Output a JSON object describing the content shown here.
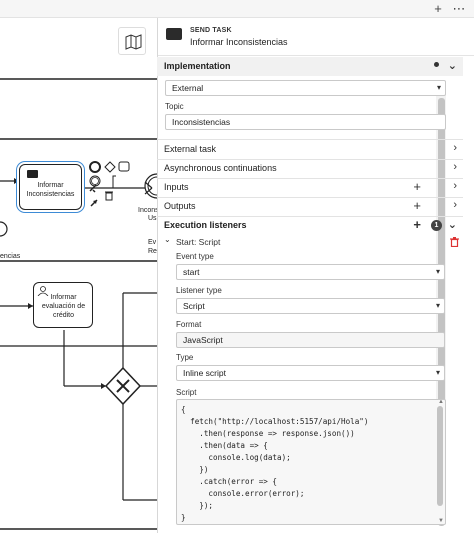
{
  "window": {
    "plus_icon": "+",
    "more_icon": "⋯"
  },
  "canvas": {
    "task_informar_inconsistencias": "Informar Inconsistencias",
    "task_informar_evaluacion": "Informar evaluación de crédito",
    "partial_label_left": "encias",
    "partial_label_1": "Incons",
    "partial_label_2": "Us",
    "partial_label_3": "Ev",
    "partial_label_4": "Re"
  },
  "panel": {
    "element_type": "SEND TASK",
    "element_name": "Informar Inconsistencias",
    "implementation_header": "Implementation",
    "type_value": "External",
    "topic_label": "Topic",
    "topic_value": "Inconsistencias",
    "groups": {
      "external_task": "External task",
      "async": "Asynchronous continuations",
      "inputs": "Inputs",
      "outputs": "Outputs",
      "execution_listeners": "Execution listeners",
      "listeners_count": "1"
    },
    "listener": {
      "title": "Start: Script",
      "event_type_label": "Event type",
      "event_type_value": "start",
      "listener_type_label": "Listener type",
      "listener_type_value": "Script",
      "format_label": "Format",
      "format_value": "JavaScript",
      "type_label": "Type",
      "type_value": "Inline script",
      "script_label": "Script",
      "script_value": "{\n  fetch(\"http://localhost:5157/api/Hola\")\n    .then(response => response.json())\n    .then(data => {\n      console.log(data);\n    })\n    .catch(error => {\n      console.error(error);\n    });\n}"
    }
  }
}
